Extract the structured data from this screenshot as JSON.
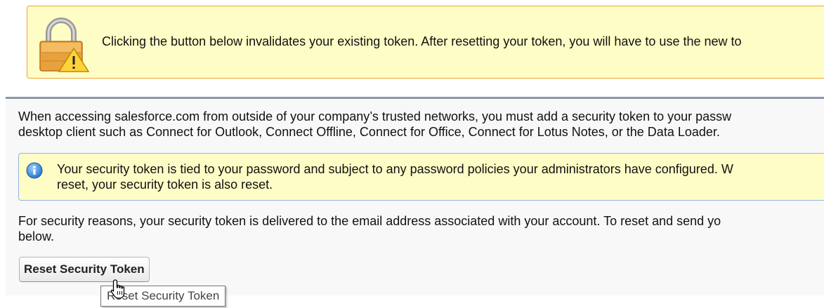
{
  "warning": {
    "icon": "lock-warning-icon",
    "text": "Clicking the button below invalidates your existing token. After resetting your token, you will have to use the new to"
  },
  "intro": {
    "line1": "When accessing salesforce.com from outside of your company’s trusted networks, you must add a security token to your passw",
    "line2": "desktop client such as Connect for Outlook, Connect Offline, Connect for Office, Connect for Lotus Notes, or the Data Loader."
  },
  "info": {
    "icon": "info-icon",
    "line1": "Your security token is tied to your password and subject to any password policies your administrators have configured. W",
    "line2": "reset, your security token is also reset."
  },
  "delivery": {
    "line1": "For security reasons, your security token is delivered to the email address associated with your account. To reset and send yo",
    "line2": "below."
  },
  "reset_button": {
    "label": "Reset Security Token"
  },
  "tooltip": {
    "text": "Reset Security Token"
  },
  "colors": {
    "warning_bg": "#fffdc6",
    "warning_border": "#f0a52d",
    "info_border": "#8fb5e0",
    "divider": "#8a97a6"
  }
}
